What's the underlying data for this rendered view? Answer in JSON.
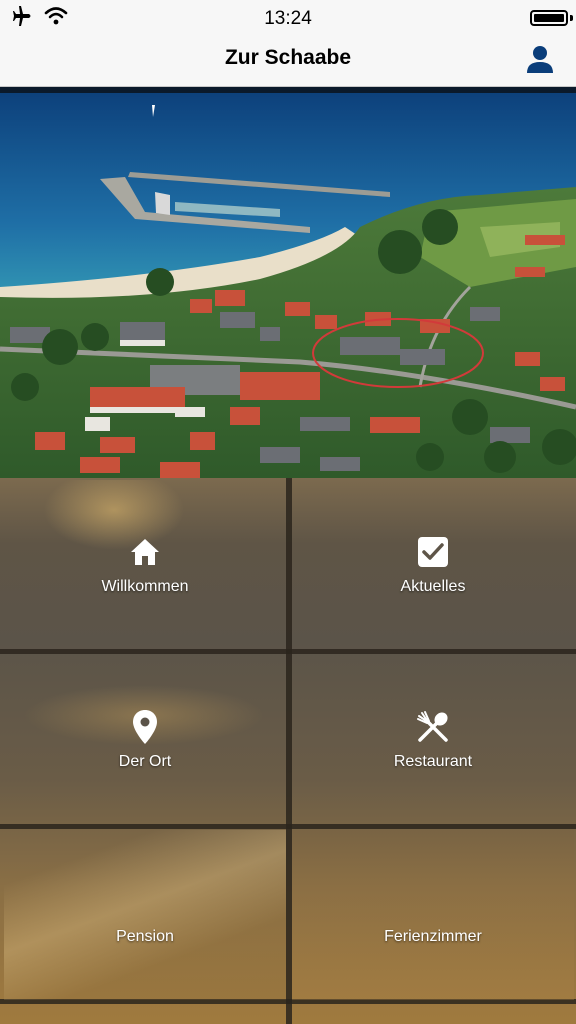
{
  "status_bar": {
    "time": "13:24",
    "icons": [
      "airplane-icon",
      "wifi-icon",
      "battery-icon"
    ]
  },
  "nav": {
    "title": "Zur Schaabe",
    "right_icon": "user-icon"
  },
  "hero": {
    "alt": "aerial-photo"
  },
  "menu": {
    "tiles": [
      {
        "label": "Willkommen",
        "icon": "home-icon"
      },
      {
        "label": "Aktuelles",
        "icon": "checkbox-icon"
      },
      {
        "label": "Der Ort",
        "icon": "location-pin-icon"
      },
      {
        "label": "Restaurant",
        "icon": "fork-spoon-icon"
      },
      {
        "label": "Pension",
        "icon": ""
      },
      {
        "label": "Ferienzimmer",
        "icon": ""
      }
    ]
  },
  "colors": {
    "accent": "#0a3d7a",
    "nav_bg": "#f7f7f7",
    "tile_text": "#ffffff"
  }
}
